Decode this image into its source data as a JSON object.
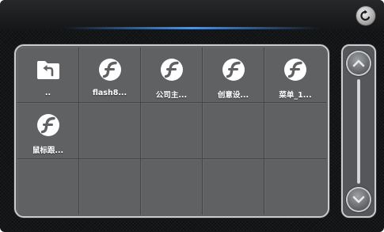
{
  "header": {
    "back_icon": "back-arrow-icon"
  },
  "files": [
    {
      "label": "..",
      "icon": "folder-up-icon"
    },
    {
      "label": "flash8...",
      "icon": "flash-file-icon"
    },
    {
      "label": "公司主...",
      "icon": "flash-file-icon"
    },
    {
      "label": "创意设...",
      "icon": "flash-file-icon"
    },
    {
      "label": "菜单_1...",
      "icon": "flash-file-icon"
    },
    {
      "label": "鼠标跟...",
      "icon": "flash-file-icon"
    }
  ],
  "scrollbar": {
    "up_icon": "chevron-up-icon",
    "down_icon": "chevron-down-icon"
  },
  "colors": {
    "panel": "#5f6163",
    "border": "#c9cbcd",
    "background": "#0f1011"
  }
}
